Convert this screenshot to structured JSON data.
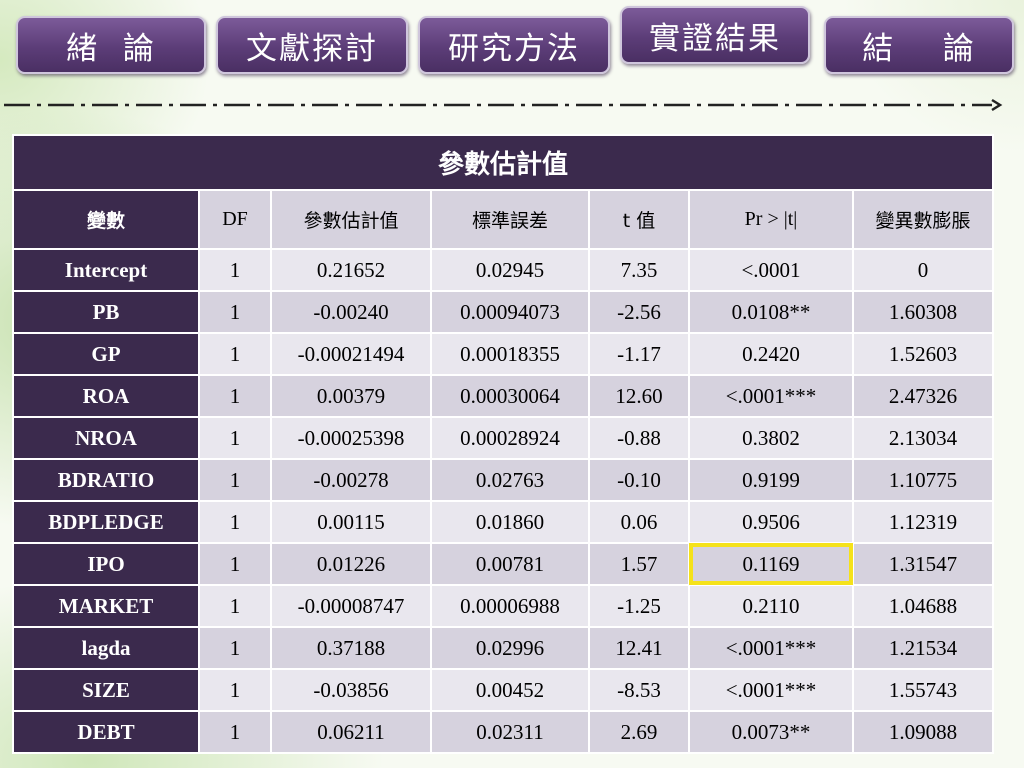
{
  "nav": {
    "items": [
      {
        "label": "緒  論"
      },
      {
        "label": "文獻探討"
      },
      {
        "label": "研究方法"
      },
      {
        "label": "實證結果"
      },
      {
        "label": "結    論"
      }
    ]
  },
  "table": {
    "title": "參數估計值",
    "headers": [
      "變數",
      "DF",
      "參數估計值",
      "標準誤差",
      "t 值",
      "Pr > |t|",
      "變異數膨脹"
    ],
    "rows": [
      [
        "Intercept",
        "1",
        "0.21652",
        "0.02945",
        "7.35",
        "<.0001",
        "0"
      ],
      [
        "PB",
        "1",
        "-0.00240",
        "0.00094073",
        "-2.56",
        "0.0108**",
        "1.60308"
      ],
      [
        "GP",
        "1",
        "-0.00021494",
        "0.00018355",
        "-1.17",
        "0.2420",
        "1.52603"
      ],
      [
        "ROA",
        "1",
        "0.00379",
        "0.00030064",
        "12.60",
        "<.0001***",
        "2.47326"
      ],
      [
        "NROA",
        "1",
        "-0.00025398",
        "0.00028924",
        "-0.88",
        "0.3802",
        "2.13034"
      ],
      [
        "BDRATIO",
        "1",
        "-0.00278",
        "0.02763",
        "-0.10",
        "0.9199",
        "1.10775"
      ],
      [
        "BDPLEDGE",
        "1",
        "0.00115",
        "0.01860",
        "0.06",
        "0.9506",
        "1.12319"
      ],
      [
        "IPO",
        "1",
        "0.01226",
        "0.00781",
        "1.57",
        "0.1169",
        "1.31547"
      ],
      [
        "MARKET",
        "1",
        "-0.00008747",
        "0.00006988",
        "-1.25",
        "0.2110",
        "1.04688"
      ],
      [
        "lagda",
        "1",
        "0.37188",
        "0.02996",
        "12.41",
        "<.0001***",
        "1.21534"
      ],
      [
        "SIZE",
        "1",
        "-0.03856",
        "0.00452",
        "-8.53",
        "<.0001***",
        "1.55743"
      ],
      [
        "DEBT",
        "1",
        "0.06211",
        "0.02311",
        "2.69",
        "0.0073**",
        "1.09088"
      ]
    ]
  },
  "colors": {
    "nav_button": "#5c3d78",
    "table_dark": "#3b2a4d",
    "row_light": "#e9e7ee",
    "row_medium": "#d6d2de",
    "highlight": "#f5e21a"
  }
}
